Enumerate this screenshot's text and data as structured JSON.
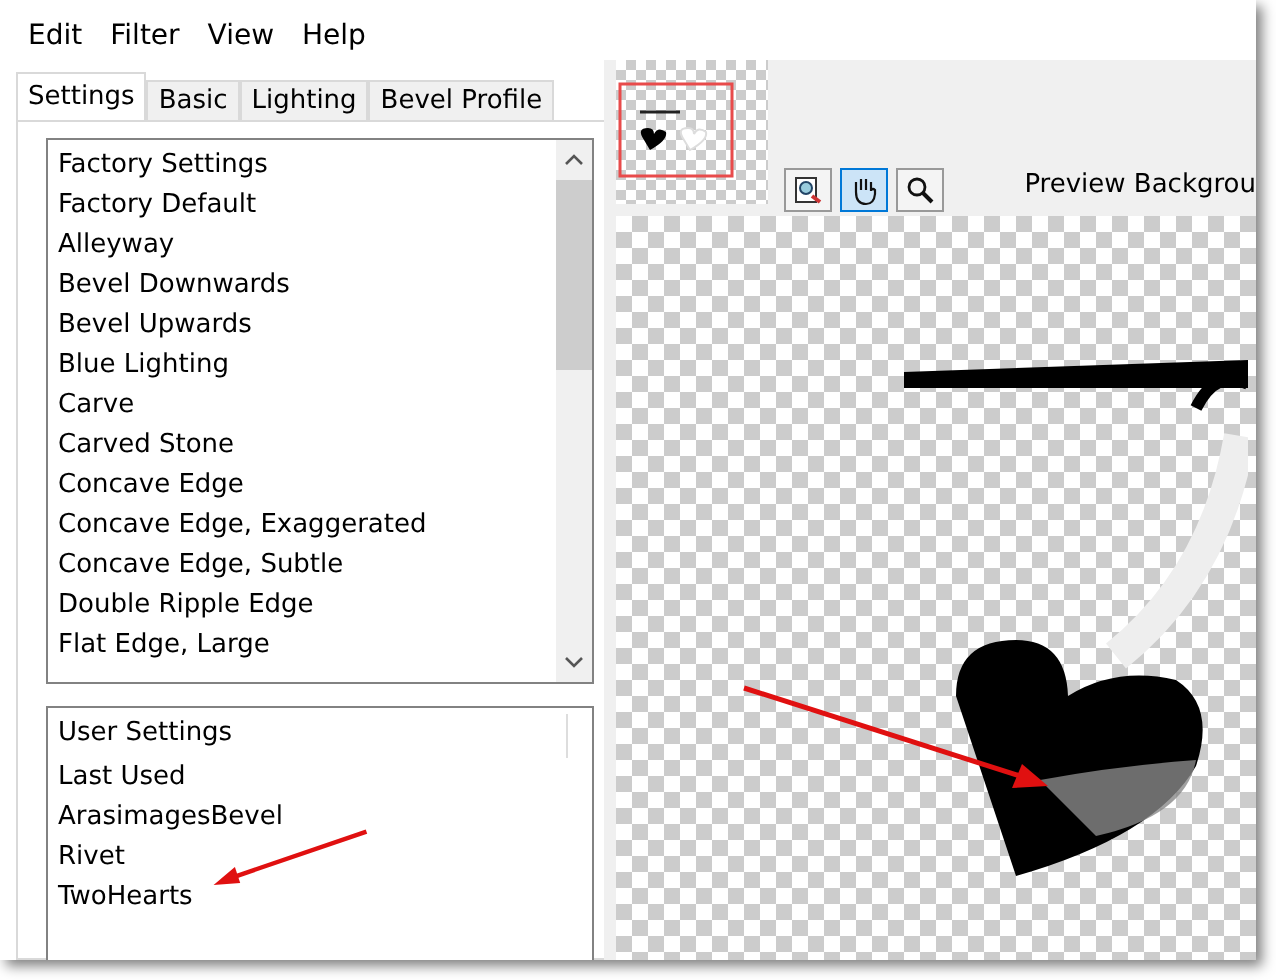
{
  "menu": [
    "Edit",
    "Filter",
    "View",
    "Help"
  ],
  "tabs": [
    {
      "label": "Settings",
      "selected": true
    },
    {
      "label": "Basic",
      "selected": false
    },
    {
      "label": "Lighting",
      "selected": false
    },
    {
      "label": "Bevel Profile",
      "selected": false
    }
  ],
  "factory_settings": {
    "header": "Factory Settings",
    "items": [
      "Factory Default",
      "Alleyway",
      "Bevel Downwards",
      "Bevel Upwards",
      "Blue Lighting",
      "Carve",
      "Carved Stone",
      "Concave Edge",
      "Concave Edge, Exaggerated",
      "Concave Edge, Subtle",
      "Double Ripple Edge",
      "Flat Edge, Large"
    ]
  },
  "user_settings": {
    "header": "User Settings",
    "items": [
      "Last Used",
      "ArasimagesBevel",
      "Rivet",
      "TwoHearts"
    ]
  },
  "preview": {
    "background_label": "Preview Backgrou"
  }
}
